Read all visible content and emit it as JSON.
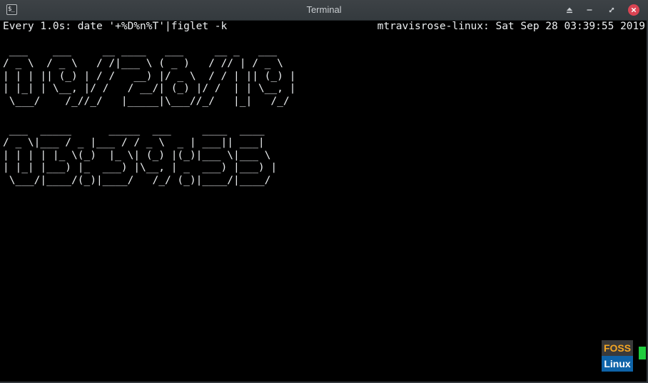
{
  "window": {
    "title": "Terminal",
    "app_icon_glyph": "$_",
    "close_color": "#da4453",
    "titlebar_color": "#3a3f43"
  },
  "titlebar_buttons": {
    "keep_above_icon": "eject-icon",
    "minimize_icon": "minimize-icon",
    "maximize_icon": "restore-icon",
    "close_icon": "close-icon"
  },
  "terminal": {
    "background": "#000000",
    "foreground": "#eceff1",
    "watch_header": "Every 1.0s: date '+%D%n%T'|figlet -k",
    "watch_host_time": "mtravisrose-linux: Sat Sep 28 03:39:55 2019",
    "figlet_date_rendered": " ___    ___     __ ____   ___     __ _   ___ \n/ _ \\  / _ \\   / /|___ \\ ( _ )   / // | / _ \\\n| | | || (_) | / /   __) |/ _ \\  / / | || (_) |\n| |_| | \\__, |/ /   / __/| (_) |/ /  | | \\__, |\n \\___/    /_//_/   |_____|\\___//_/   |_|   /_/ ",
    "figlet_time_rendered": " ___  _____      _____  ___     ____  ____ \n/ _ \\|___ / _ |___ / / _ \\  _ | ___|| ___|\n| | | | |_ \\(_)  |_ \\| (_) |(_)|___ \\|___ \\\n| |_| |___) |_  ___) |\\__, | _  ___) |___) |\n \\___/|____/(_)|____/   /_/ (_)|____/|____/ ",
    "cursor_color": "#1fcc3e"
  },
  "watermark": {
    "top_text": "FOSS",
    "bottom_text": "Linux",
    "top_color": "#f5a623",
    "bottom_bg": "#0e63a8"
  }
}
